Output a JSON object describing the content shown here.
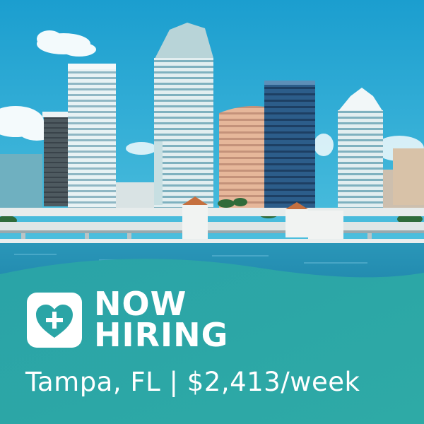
{
  "ad": {
    "headline": [
      "NOW",
      "HIRING"
    ],
    "subline": "Tampa, FL | $2,413/week",
    "logo_icon": "heart-plus-icon"
  },
  "colors": {
    "sky": "#2aa6cc",
    "water": "#1f8fb4",
    "banner": "#2aa7a5",
    "text": "#ffffff"
  }
}
